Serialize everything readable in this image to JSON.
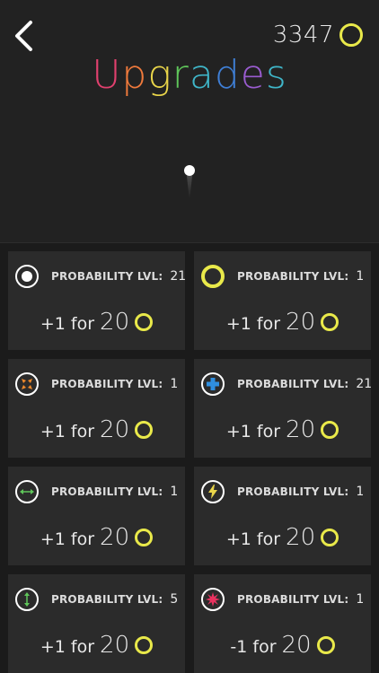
{
  "header": {
    "coins": "3347",
    "title_letters": [
      {
        "ch": "U",
        "color": "#e0406e"
      },
      {
        "ch": "p",
        "color": "#f07a3c"
      },
      {
        "ch": "g",
        "color": "#e9d54a"
      },
      {
        "ch": "r",
        "color": "#5fc65a"
      },
      {
        "ch": "a",
        "color": "#3fb6c9"
      },
      {
        "ch": "d",
        "color": "#3f7fd6"
      },
      {
        "ch": "e",
        "color": "#9a5cd0"
      },
      {
        "ch": "s",
        "color": "#3fb6c9"
      }
    ]
  },
  "colors": {
    "coin": "#e9e94a",
    "background": "#222222",
    "card": "#2b2b2b"
  },
  "upgrades": [
    {
      "icon": "white-dot-icon",
      "label": "PROBABILITY LVL:",
      "level": "21",
      "buy_text": "+1 for",
      "price": "20"
    },
    {
      "icon": "yellow-ring-icon",
      "label": "PROBABILITY LVL:",
      "level": "1",
      "buy_text": "+1 for",
      "price": "20"
    },
    {
      "icon": "orange-shrink-arrows-icon",
      "label": "PROBABILITY LVL:",
      "level": "1",
      "buy_text": "+1 for",
      "price": "20"
    },
    {
      "icon": "blue-plus-icon",
      "label": "PROBABILITY LVL:",
      "level": "21",
      "buy_text": "+1 for",
      "price": "20"
    },
    {
      "icon": "green-horizontal-arrow-icon",
      "label": "PROBABILITY LVL:",
      "level": "1",
      "buy_text": "+1 for",
      "price": "20"
    },
    {
      "icon": "yellow-lightning-icon",
      "label": "PROBABILITY LVL:",
      "level": "1",
      "buy_text": "+1 for",
      "price": "20"
    },
    {
      "icon": "green-vertical-arrow-icon",
      "label": "PROBABILITY LVL:",
      "level": "5",
      "buy_text": "+1 for",
      "price": "20"
    },
    {
      "icon": "pink-star-burst-icon",
      "label": "PROBABILITY LVL:",
      "level": "1",
      "buy_text": "-1 for",
      "price": "20"
    }
  ]
}
